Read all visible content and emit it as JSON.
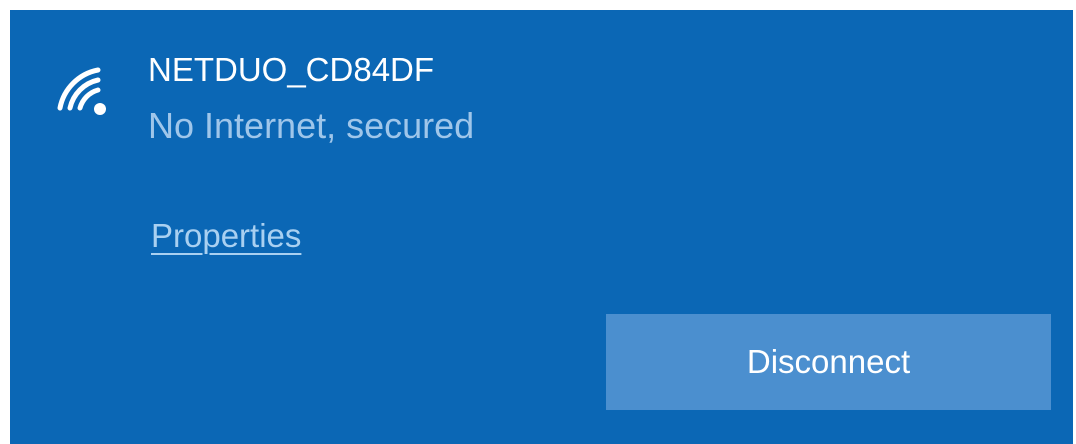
{
  "network": {
    "ssid": "NETDUO_CD84DF",
    "status": "No Internet, secured",
    "icon": "wifi-warning-icon",
    "properties_label": "Properties",
    "disconnect_label": "Disconnect"
  },
  "colors": {
    "panel_background": "#0b67b5",
    "button_background": "#4b8fcf",
    "status_text": "#9fc6ea",
    "link_text": "#a9d0f1",
    "primary_text": "#ffffff"
  }
}
